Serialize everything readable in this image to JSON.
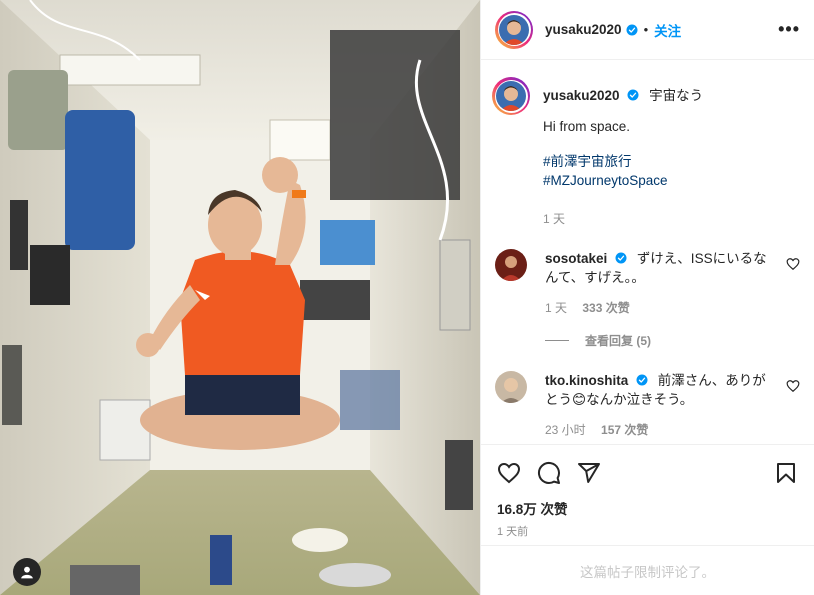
{
  "post": {
    "author": "yusaku2020",
    "follow_label": "关注",
    "dot": "•",
    "more_label": "•••",
    "caption_first": "宇宙なう",
    "caption_body": "Hi from space.",
    "hashtags": [
      "#前澤宇宙旅行",
      "#MZJourneytoSpace"
    ],
    "caption_time": "1 天",
    "likes": "16.8万 次赞",
    "date": "1 天前",
    "comments_disabled": "这篇帖子限制评论了。"
  },
  "comments": [
    {
      "user": "sosotakei",
      "text": "ずけえ、ISSにいるなんて、すげえ。。",
      "time": "1 天",
      "likes": "333 次赞",
      "view_replies": "查看回复 (5)"
    },
    {
      "user": "tko.kinoshita",
      "text": "前澤さん、ありがとう😊なんか泣きそう。",
      "time": "23 小时",
      "likes": "157 次赞"
    }
  ],
  "icons": {
    "heart": "heart-icon",
    "comment": "comment-icon",
    "share": "share-icon",
    "bookmark": "bookmark-icon",
    "verified": "verified-badge-icon",
    "user_tag": "user-tag-icon"
  },
  "colors": {
    "accent": "#0095f6",
    "hashtag": "#00376b",
    "muted": "#8e8e8e"
  }
}
